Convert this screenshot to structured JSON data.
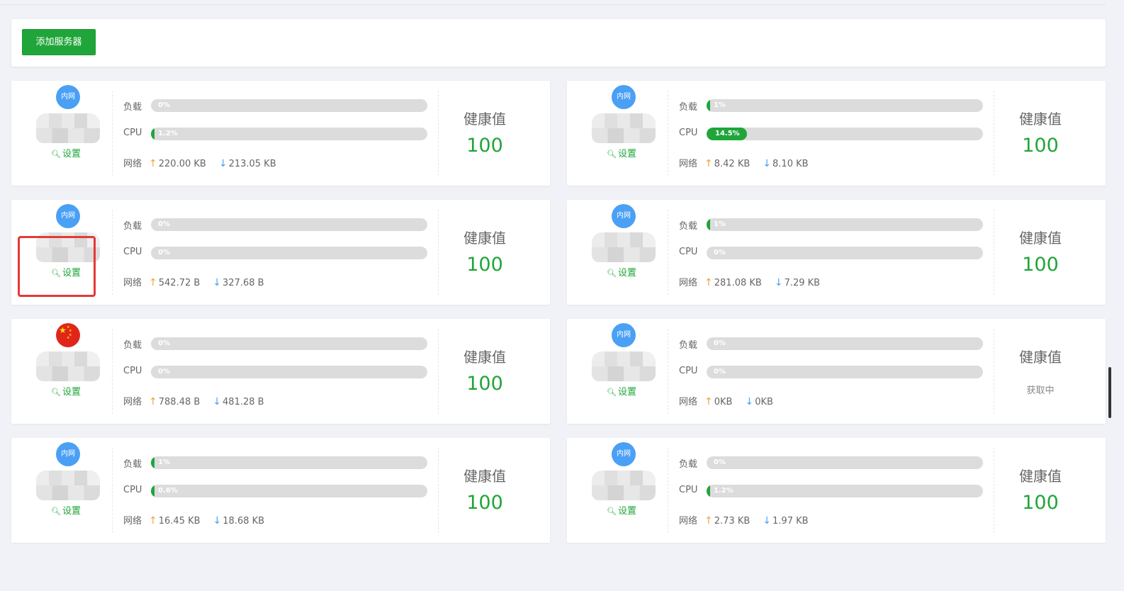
{
  "toolbar": {
    "add_server_label": "添加服务器"
  },
  "labels": {
    "load": "负载",
    "cpu": "CPU",
    "network": "网络",
    "health": "健康值",
    "settings": "设置",
    "intranet": "内网"
  },
  "colors": {
    "accent": "#20a53a",
    "badge": "#4aa0f5",
    "upload": "#f0a33a",
    "download": "#4aa0f5",
    "highlight": "#e53935"
  },
  "servers": [
    {
      "badge": "intranet",
      "load": "0%",
      "load_pct": 0,
      "cpu": "1.2%",
      "cpu_pct": 1.2,
      "up": "220.00 KB",
      "down": "213.05 KB",
      "health": "100"
    },
    {
      "badge": "intranet",
      "load": "1%",
      "load_pct": 1,
      "cpu": "14.5%",
      "cpu_pct": 14.5,
      "up": "8.42 KB",
      "down": "8.10 KB",
      "health": "100"
    },
    {
      "badge": "intranet",
      "load": "0%",
      "load_pct": 0,
      "cpu": "0%",
      "cpu_pct": 0,
      "up": "542.72 B",
      "down": "327.68 B",
      "health": "100"
    },
    {
      "badge": "intranet",
      "load": "1%",
      "load_pct": 1,
      "cpu": "0%",
      "cpu_pct": 0,
      "up": "281.08 KB",
      "down": "7.29 KB",
      "health": "100"
    },
    {
      "badge": "china-flag",
      "load": "0%",
      "load_pct": 0,
      "cpu": "0%",
      "cpu_pct": 0,
      "up": "788.48 B",
      "down": "481.28 B",
      "health": "100"
    },
    {
      "badge": "intranet",
      "load": "0%",
      "load_pct": 0,
      "cpu": "0%",
      "cpu_pct": 0,
      "up": "0KB",
      "down": "0KB",
      "health": "",
      "health_status": "获取中"
    },
    {
      "badge": "intranet",
      "load": "1%",
      "load_pct": 1,
      "cpu": "0.6%",
      "cpu_pct": 0.6,
      "up": "16.45 KB",
      "down": "18.68 KB",
      "health": "100"
    },
    {
      "badge": "intranet",
      "load": "0%",
      "load_pct": 0,
      "cpu": "1.2%",
      "cpu_pct": 1.2,
      "up": "2.73 KB",
      "down": "1.97 KB",
      "health": "100"
    }
  ]
}
